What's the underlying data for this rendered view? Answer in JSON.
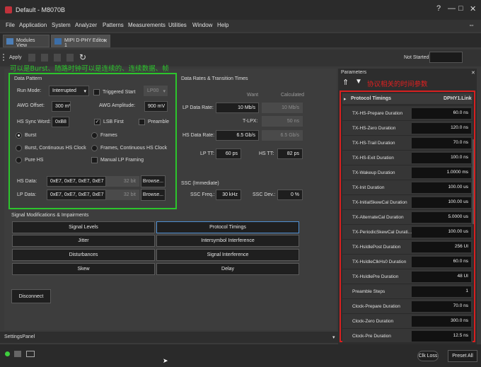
{
  "window": {
    "title": "Default - M8070B",
    "help": "?",
    "minimize": "—",
    "maximize": "□",
    "close": "✕"
  },
  "menu": [
    "File",
    "Application",
    "System",
    "Analyzer",
    "Patterns",
    "Measurements",
    "Utilities",
    "Window",
    "Help"
  ],
  "tabs": {
    "modules": "Modules View",
    "editor": "MIPI D-PHY Editor 1",
    "editor_close": "✕"
  },
  "toolbar": {
    "apply": "Apply",
    "status_label": "Not Started"
  },
  "annotations": {
    "green": "可以是Burst、随路时钟可以是连续的、连续数据、帧",
    "red": "协议相关的时间参数"
  },
  "data_pattern": {
    "title": "Data Pattern",
    "run_mode_label": "Run Mode:",
    "run_mode_value": "Interrupted",
    "triggered_start": "Triggered Start",
    "lp00": "LP00",
    "awg_offset_label": "AWG Offset:",
    "awg_offset_value": "300 mV",
    "awg_amp_label": "AWG Amplitude:",
    "awg_amp_value": "900 mV",
    "hs_sync_label": "HS Sync Word:",
    "hs_sync_value": "0xB8",
    "lsb_first": "LSB First",
    "preamble": "Preamble",
    "modes": [
      "Burst",
      "Frames",
      "Burst, Continuous HS Clock",
      "Frames, Continuous HS Clock",
      "Pure HS",
      "Manual LP Framing"
    ],
    "hs_data_label": "HS Data:",
    "hs_data_value": "0xE7, 0xE7, 0xE7, 0xE7",
    "hs_data_bits": "32 bit",
    "lp_data_label": "LP Data:",
    "lp_data_value": "0xE7, 0xE7, 0xE7, 0xE7",
    "lp_data_bits": "32 bit",
    "browse": "Browse..."
  },
  "rates": {
    "title": "Data Rates & Transition Times",
    "want": "Want",
    "calculated": "Calculated",
    "lp_rate_label": "LP Data Rate:",
    "lp_rate_want": "10 Mb/s",
    "lp_rate_calc": "10 Mb/s",
    "tlpx_label": "T-LPX:",
    "tlpx_calc": "50 ns",
    "hs_rate_label": "HS Data Rate:",
    "hs_rate_want": "6.5 Gb/s",
    "hs_rate_calc": "6.5 Gb/s",
    "lp_tt_label": "LP TT:",
    "lp_tt_value": "60 ps",
    "hs_tt_label": "HS TT:",
    "hs_tt_value": "82 ps"
  },
  "ssc": {
    "title": "SSC (Immediate)",
    "freq_label": "SSC Freq.:",
    "freq_value": "30 kHz",
    "dev_label": "SSC Dev.:",
    "dev_value": "0 %"
  },
  "signal_mods": {
    "title": "Signal Modifications & Impairments",
    "buttons": [
      "Signal Levels",
      "Protocol Timings",
      "Jitter",
      "Intersymbol Interference",
      "Disturbances",
      "Signal Interference",
      "Skew",
      "Delay"
    ]
  },
  "disconnect": "Disconnect",
  "settings_panel": "SettingsPanel",
  "parameters": {
    "title": "Parameters",
    "section": "Protocol Timings",
    "link": "DPHY1.Link",
    "rows": [
      {
        "name": "TX-HS-Prepare Duration",
        "value": "60.0 ns"
      },
      {
        "name": "TX-HS-Zero Duration",
        "value": "120.0 ns"
      },
      {
        "name": "TX-HS-Trail Duration",
        "value": "70.0 ns"
      },
      {
        "name": "TX-HS-Exit Duration",
        "value": "100.0 ns"
      },
      {
        "name": "TX-Wakeup Duration",
        "value": "1.0000 ms"
      },
      {
        "name": "TX-Init Duration",
        "value": "100.00 us"
      },
      {
        "name": "TX-InitialSkewCal Duration",
        "value": "100.00 us"
      },
      {
        "name": "TX-AlternateCal Duration",
        "value": "5.0000 us"
      },
      {
        "name": "TX-PeriodicSkewCal Durati...",
        "value": "100.00 us"
      },
      {
        "name": "TX-HsIdlePost Duration",
        "value": "256 UI"
      },
      {
        "name": "TX-HsIdleClkHs0 Duration",
        "value": "60.0 ns"
      },
      {
        "name": "TX-HsIdlePre Duration",
        "value": "48 UI"
      },
      {
        "name": "Preamble Steps",
        "value": "1"
      },
      {
        "name": "Clock-Prepare Duration",
        "value": "70.0 ns"
      },
      {
        "name": "Clock-Zero Duration",
        "value": "300.0 ns"
      },
      {
        "name": "Clock-Pre Duration",
        "value": "12.5 ns"
      }
    ]
  },
  "status": {
    "clk_loss": "Clk Loss",
    "preset_all": "Preset All"
  },
  "colors": {
    "green_annotation": "#2cc52c",
    "red_annotation": "#d62020",
    "accent_blue": "#4f8fd1"
  }
}
